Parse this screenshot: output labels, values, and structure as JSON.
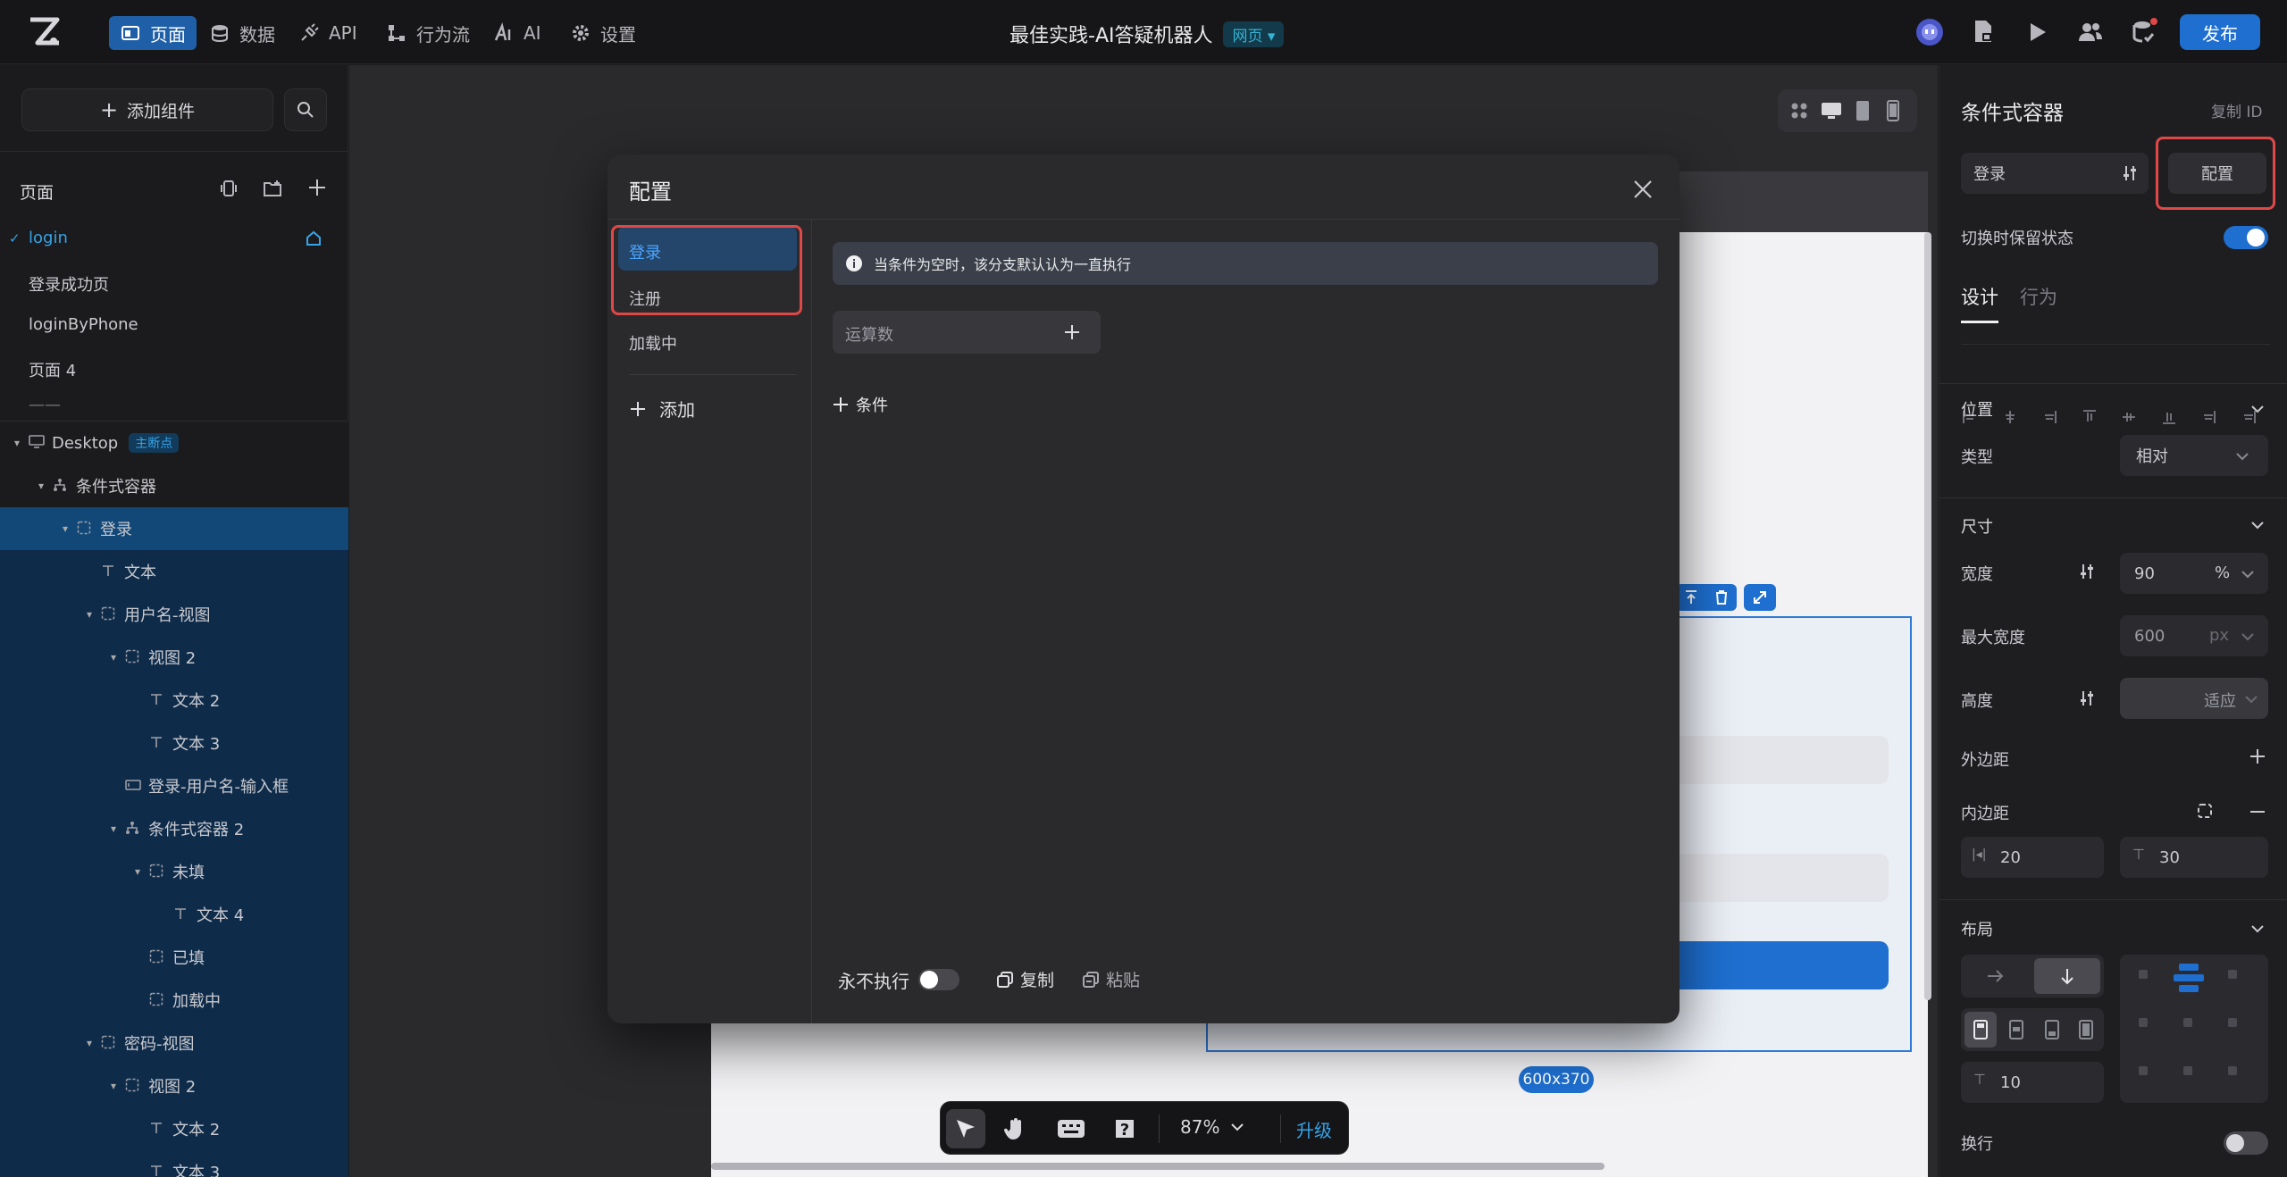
{
  "topbar": {
    "nav": [
      "页面",
      "数据",
      "API",
      "行为流",
      "AI",
      "设置"
    ],
    "title": "最佳实践-AI答疑机器人",
    "page_type": "网页",
    "publish": "发布"
  },
  "left": {
    "add_component": "添加组件",
    "pages_header": "页面",
    "pages": [
      "login",
      "登录成功页",
      "loginByPhone",
      "页面 4",
      "——"
    ],
    "tree": [
      {
        "label": "Desktop",
        "badge": "主断点",
        "indent": 0,
        "arrow": true,
        "icon": "monitor"
      },
      {
        "label": "条件式容器",
        "indent": 1,
        "arrow": true,
        "icon": "branch"
      },
      {
        "label": "登录",
        "indent": 2,
        "arrow": true,
        "icon": "dashed",
        "selected": true
      },
      {
        "label": "文本",
        "indent": 3,
        "arrow": false,
        "icon": "T"
      },
      {
        "label": "用户名-视图",
        "indent": 3,
        "arrow": true,
        "icon": "dashed"
      },
      {
        "label": "视图 2",
        "indent": 4,
        "arrow": true,
        "icon": "dashed"
      },
      {
        "label": "文本 2",
        "indent": 5,
        "arrow": false,
        "icon": "T"
      },
      {
        "label": "文本 3",
        "indent": 5,
        "arrow": false,
        "icon": "T"
      },
      {
        "label": "登录-用户名-输入框",
        "indent": 4,
        "arrow": false,
        "icon": "input"
      },
      {
        "label": "条件式容器 2",
        "indent": 4,
        "arrow": true,
        "icon": "branch"
      },
      {
        "label": "未填",
        "indent": 5,
        "arrow": true,
        "icon": "dashed"
      },
      {
        "label": "文本 4",
        "indent": 6,
        "arrow": false,
        "icon": "T"
      },
      {
        "label": "已填",
        "indent": 5,
        "arrow": false,
        "icon": "dashed"
      },
      {
        "label": "加载中",
        "indent": 5,
        "arrow": false,
        "icon": "dashed"
      },
      {
        "label": "密码-视图",
        "indent": 3,
        "arrow": true,
        "icon": "dashed"
      },
      {
        "label": "视图 2",
        "indent": 4,
        "arrow": true,
        "icon": "dashed"
      },
      {
        "label": "文本 2",
        "indent": 5,
        "arrow": false,
        "icon": "T"
      },
      {
        "label": "文本 3",
        "indent": 5,
        "arrow": false,
        "icon": "T"
      }
    ]
  },
  "modal": {
    "title": "配置",
    "branches": [
      "登录",
      "注册",
      "加载中"
    ],
    "add": "添加",
    "info": "当条件为空时，该分支默认认为一直执行",
    "operand": "运算数",
    "condition": "条件",
    "never_exec": "永不执行",
    "copy": "复制",
    "paste": "粘贴"
  },
  "canvas": {
    "size_label": "600x370",
    "zoom": "87%",
    "upgrade": "升级"
  },
  "right": {
    "title": "条件式容器",
    "copy_id": "复制 ID",
    "branch_select": "登录",
    "config_btn": "配置",
    "keep_state": "切换时保留状态",
    "tabs": [
      "设计",
      "行为"
    ],
    "position": "位置",
    "type_label": "类型",
    "type_value": "相对",
    "size": "尺寸",
    "width_label": "宽度",
    "width_value": "90",
    "width_unit": "%",
    "maxw_label": "最大宽度",
    "maxw_value": "600",
    "maxw_unit": "px",
    "height_label": "高度",
    "height_value": "适应",
    "margin": "外边距",
    "padding": "内边距",
    "pad_h": "20",
    "pad_v": "30",
    "layout": "布局",
    "gap": "10",
    "wrap": "换行"
  },
  "colors": {
    "accent": "#1e6fd0",
    "highlight": "#e04848",
    "selected_row": "#0f3559"
  }
}
